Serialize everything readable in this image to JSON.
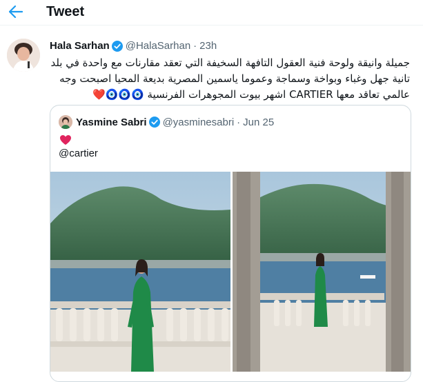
{
  "header": {
    "title": "Tweet",
    "back_icon": "arrow-left-icon"
  },
  "tweet": {
    "author_name": "Hala Sarhan",
    "author_handle": "@HalaSarhan",
    "separator": "·",
    "time": "23h",
    "text": "جميلة وانيقة ولوحة فنية العقول التافهة السخيفة التي تعقد مقارنات مع واحدة في بلد تانية جهل وغباء وبواخة وسماجة وعموما ياسمين المصرية بديعة المحيا اصبحت وجه عالمي تعاقد معها CARTIER اشهر بيوت المجوهرات الفرنسية",
    "emoji": "❤️🧿🧿🧿"
  },
  "quoted": {
    "author_name": "Yasmine Sabri",
    "author_handle": "@yasminesabri",
    "separator": "·",
    "date": "Jun 25",
    "heart": "❤",
    "mention": "@cartier"
  },
  "colors": {
    "accent": "#1d9bf0",
    "secondary_text": "#536471",
    "border": "#cfd9de",
    "heart": "#e0245e",
    "dress": "#1f8a48"
  }
}
